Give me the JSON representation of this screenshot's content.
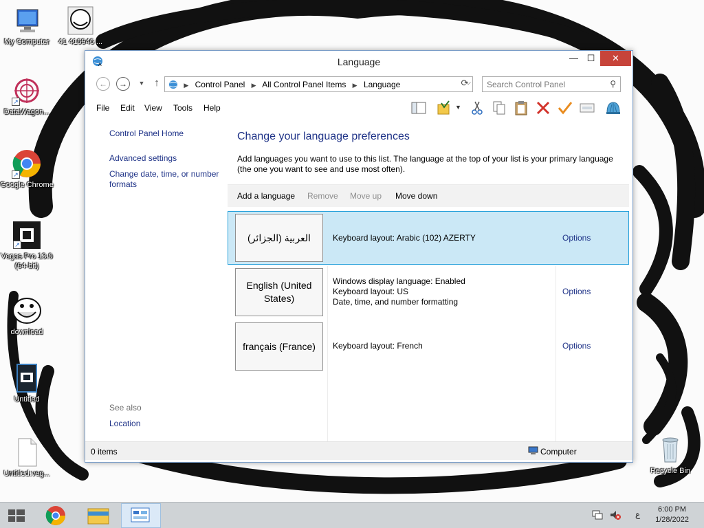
{
  "desktop": {
    "icons": [
      {
        "label": "My Computer"
      },
      {
        "label": "41 416946 ..."
      },
      {
        "label": "DataWagon..."
      },
      {
        "label": "Google Chrome"
      },
      {
        "label": "Vegas Pro 13.0 (64-bit)"
      },
      {
        "label": "download"
      },
      {
        "label": "Untitled"
      },
      {
        "label": "Untitled.veg..."
      },
      {
        "label": "Recycle Bin"
      }
    ]
  },
  "window": {
    "title": "Language",
    "controls": {
      "minimize": "—",
      "maximize": "☐",
      "close": "✕"
    },
    "breadcrumb": [
      "Control Panel",
      "All Control Panel Items",
      "Language"
    ],
    "search_placeholder": "Search Control Panel",
    "menu": [
      "File",
      "Edit",
      "View",
      "Tools",
      "Help"
    ],
    "toolbar_icons": [
      "pane-layout-icon",
      "folder-check-icon",
      "dropdown-arrow-icon",
      "cut-icon",
      "copy-icon",
      "paste-icon",
      "delete-icon",
      "checkmark-icon",
      "properties-icon",
      "shell-icon"
    ]
  },
  "sidebar": {
    "home": "Control Panel Home",
    "links": [
      "Advanced settings",
      "Change date, time, or number formats"
    ],
    "see_also": "See also",
    "see_also_links": [
      "Location"
    ]
  },
  "main": {
    "heading": "Change your language preferences",
    "description": "Add languages you want to use to this list. The language at the top of your list is your primary language (the one you want to see and use most often).",
    "actions": [
      {
        "label": "Add a language",
        "enabled": true
      },
      {
        "label": "Remove",
        "enabled": false
      },
      {
        "label": "Move up",
        "enabled": false
      },
      {
        "label": "Move down",
        "enabled": true
      }
    ],
    "languages": [
      {
        "name": "العربية (الجزائر)",
        "details": [
          "Keyboard layout: Arabic (102) AZERTY"
        ],
        "options": "Options",
        "selected": true
      },
      {
        "name": "English (United States)",
        "details": [
          "Windows display language: Enabled",
          "Keyboard layout: US",
          "Date, time, and number formatting"
        ],
        "options": "Options",
        "selected": false
      },
      {
        "name": "français (France)",
        "details": [
          "Keyboard layout: French"
        ],
        "options": "Options",
        "selected": false
      }
    ]
  },
  "statusbar": {
    "items": "0 items",
    "location": "Computer"
  },
  "taskbar": {
    "time": "6:00 PM",
    "date": "1/28/2022",
    "input_indicator": "ع"
  },
  "colors": {
    "link": "#1e3287",
    "selection_bg": "#cbe8f6",
    "selection_border": "#26a0da",
    "close_button": "#c7443a"
  }
}
